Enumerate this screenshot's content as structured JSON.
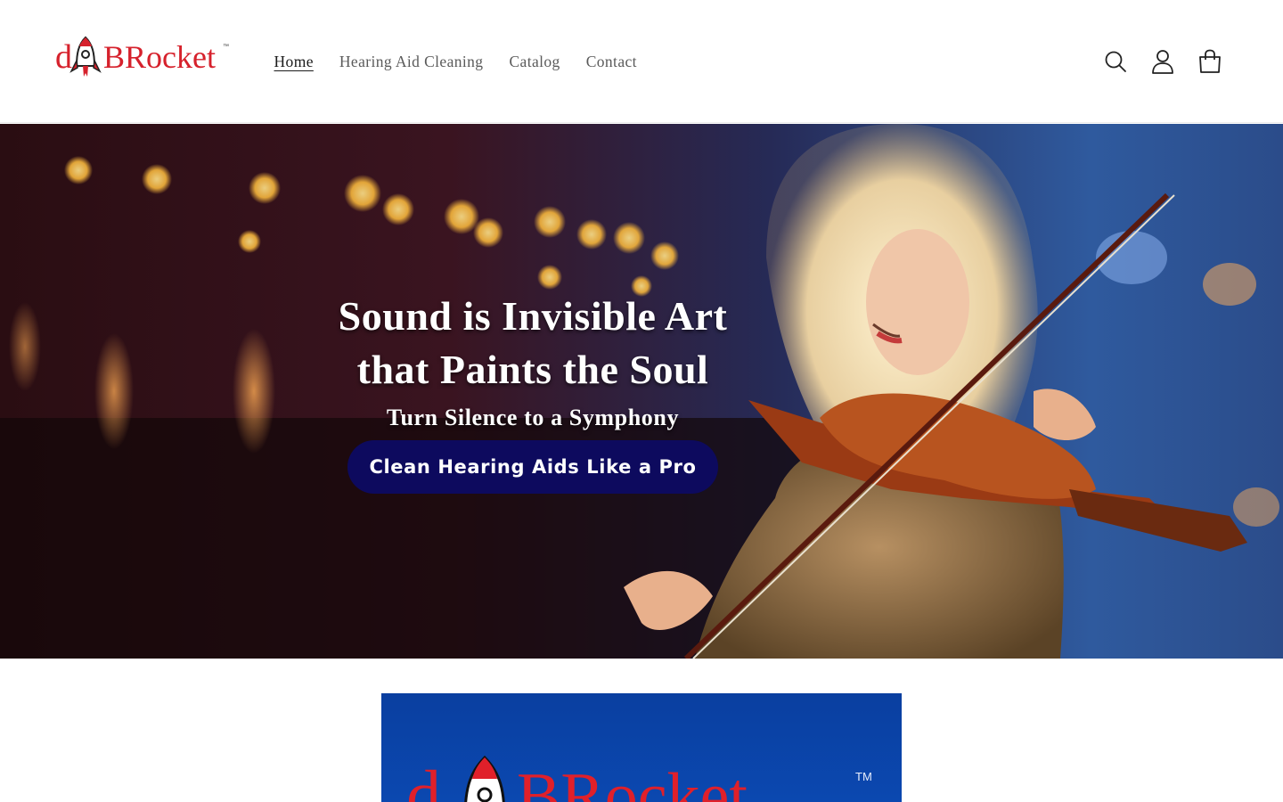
{
  "header": {
    "logo_text": "dBRocket",
    "nav": [
      {
        "label": "Home",
        "active": true
      },
      {
        "label": "Hearing Aid Cleaning",
        "active": false
      },
      {
        "label": "Catalog",
        "active": false
      },
      {
        "label": "Contact",
        "active": false
      }
    ],
    "icons": [
      "search-icon",
      "account-icon",
      "cart-icon"
    ]
  },
  "hero": {
    "title_line1": "Sound is Invisible Art",
    "title_line2": "that Paints the Soul",
    "subtitle": "Turn Silence to a Symphony",
    "button_label": "Clean Hearing Aids Like a Pro"
  },
  "promo": {
    "logo_text": "dBRocket",
    "trademark": "TM"
  },
  "colors": {
    "brand_red": "#d6212c",
    "button_navy": "#0d0a5e",
    "promo_blue": "#0b46ab",
    "nav_text": "#5a5a5a"
  }
}
